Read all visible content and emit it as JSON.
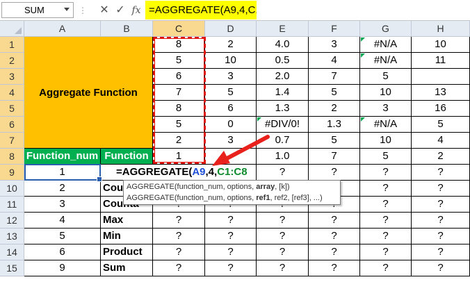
{
  "formula_bar": {
    "name_box": "SUM",
    "dots": "⋮",
    "cancel_icon": "✕",
    "enter_icon": "✓",
    "fx_label": "fx",
    "formula": "=AGGREGATE(A9,4,C1:C8"
  },
  "columns": [
    "A",
    "B",
    "C",
    "D",
    "E",
    "F",
    "G",
    "H"
  ],
  "rows": [
    "1",
    "2",
    "3",
    "4",
    "5",
    "6",
    "7",
    "8",
    "9",
    "10",
    "11",
    "12",
    "13",
    "14",
    "15"
  ],
  "title_block": "Aggregate Function",
  "header_row": {
    "a": "Function_num",
    "b": "Function"
  },
  "data": {
    "r1": [
      "8",
      "2",
      "4.0",
      "3",
      "#N/A",
      "10"
    ],
    "r2": [
      "5",
      "10",
      "0.5",
      "4",
      "#N/A",
      "11"
    ],
    "r3": [
      "6",
      "3",
      "2.0",
      "7",
      "5",
      ""
    ],
    "r4": [
      "7",
      "5",
      "1.4",
      "5",
      "10",
      "13"
    ],
    "r5": [
      "8",
      "6",
      "1.3",
      "2",
      "3",
      "16"
    ],
    "r6": [
      "5",
      "0",
      "#DIV/0!",
      "1.3",
      "#N/A",
      "5"
    ],
    "r7": [
      "2",
      "3",
      "0.7",
      "5",
      "10",
      "4"
    ],
    "r8": [
      "1",
      "",
      "1.0",
      "7",
      "5",
      "2"
    ]
  },
  "lower_rows": [
    {
      "num": "1",
      "fn": "",
      "vals": [
        "",
        "?",
        "?",
        "?",
        "?"
      ]
    },
    {
      "num": "2",
      "fn": "Cou",
      "vals": [
        "?",
        "?",
        "?",
        "?",
        "?",
        "?"
      ]
    },
    {
      "num": "3",
      "fn": "Counta",
      "vals": [
        "?",
        "?",
        "?",
        "?",
        "?",
        "?"
      ]
    },
    {
      "num": "4",
      "fn": "Max",
      "vals": [
        "?",
        "?",
        "?",
        "?",
        "?",
        "?"
      ]
    },
    {
      "num": "5",
      "fn": "Min",
      "vals": [
        "?",
        "?",
        "?",
        "?",
        "?",
        "?"
      ]
    },
    {
      "num": "6",
      "fn": "Product",
      "vals": [
        "?",
        "?",
        "?",
        "?",
        "?",
        "?"
      ]
    },
    {
      "num": "9",
      "fn": "Sum",
      "vals": [
        "?",
        "?",
        "?",
        "?",
        "?",
        "?"
      ]
    }
  ],
  "edit_formula": {
    "prefix": "=AGGREGATE(",
    "ref1": "A9",
    "mid": ",4,",
    "ref2": "C1:C8"
  },
  "tooltip": {
    "line1_start": "AGGREGATE(function_num, options, ",
    "line1_bold": "array",
    "line1_end": ", [k])",
    "line2_start": "AGGREGATE(function_num, options, ",
    "line2_bold": "ref1",
    "line2_end": ", ref2, [ref3], ...)"
  },
  "colors": {
    "title_fill": "#ffc000",
    "header_fill": "#00b050",
    "formula_highlight": "#ffff00",
    "selection_border": "#e0120c",
    "arrow": "#e8211c"
  }
}
